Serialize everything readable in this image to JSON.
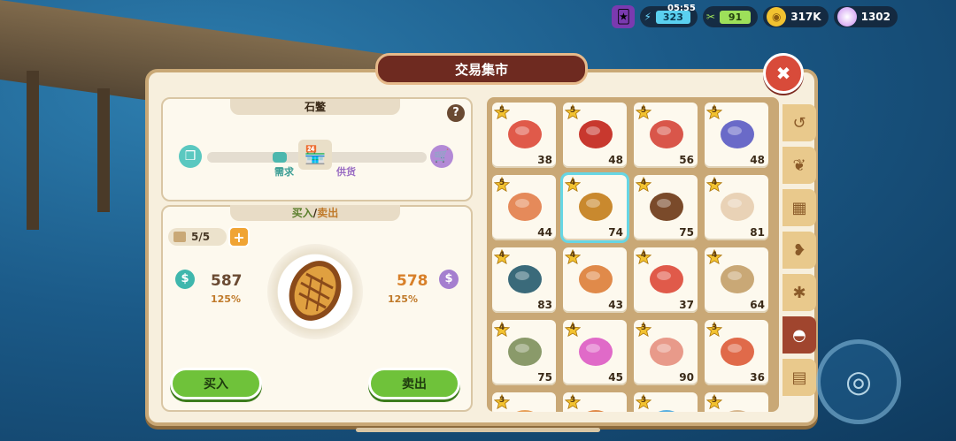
{
  "hud": {
    "energy": "323",
    "timer": "05:55",
    "stamina": "91",
    "coins": "317K",
    "gems": "1302"
  },
  "window": {
    "title": "交易集市"
  },
  "item_info": {
    "name": "石鳖",
    "demand_label": "需求",
    "supply_label": "供货",
    "demand_level": 0.33
  },
  "trade": {
    "title_buy": "买入",
    "title_slash": "/",
    "title_sell": "卖出",
    "stock": "5/5",
    "buy_price": "587",
    "sell_price": "578",
    "buy_pct": "125%",
    "sell_pct": "125%",
    "buy_button": "买入",
    "sell_button": "卖出"
  },
  "grid": [
    {
      "tier": "5",
      "count": "38",
      "icon": "crab-icon",
      "color": "#e05a4a"
    },
    {
      "tier": "5",
      "count": "48",
      "icon": "lobster-icon",
      "color": "#c8382e"
    },
    {
      "tier": "5",
      "count": "56",
      "icon": "crab-icon",
      "color": "#d9564a"
    },
    {
      "tier": "5",
      "count": "48",
      "icon": "sea-urchin-icon",
      "color": "#6a6ac8"
    },
    {
      "tier": "5",
      "count": "44",
      "icon": "clam-icon",
      "color": "#e58a5a"
    },
    {
      "tier": "4",
      "count": "74",
      "icon": "chiton-icon",
      "color": "#c9892e",
      "selected": true
    },
    {
      "tier": "4",
      "count": "75",
      "icon": "sea-cucumber-icon",
      "color": "#7a4a2a"
    },
    {
      "tier": "4",
      "count": "81",
      "icon": "squid-icon",
      "color": "#e9d2b6"
    },
    {
      "tier": "4",
      "count": "83",
      "icon": "lobster-icon",
      "color": "#3a6a7a"
    },
    {
      "tier": "4",
      "count": "43",
      "icon": "hermit-crab-icon",
      "color": "#e08a4a"
    },
    {
      "tier": "4",
      "count": "37",
      "icon": "starfish-icon",
      "color": "#e05a4a"
    },
    {
      "tier": "4",
      "count": "64",
      "icon": "oyster-icon",
      "color": "#c9a876"
    },
    {
      "tier": "4",
      "count": "75",
      "icon": "mussel-icon",
      "color": "#8a9a6a"
    },
    {
      "tier": "4",
      "count": "45",
      "icon": "sea-anemone-icon",
      "color": "#e06ac8"
    },
    {
      "tier": "3",
      "count": "90",
      "icon": "scallop-icon",
      "color": "#e89a8a"
    },
    {
      "tier": "3",
      "count": "36",
      "icon": "nautilus-icon",
      "color": "#e06a4a"
    },
    {
      "tier": "3",
      "count": "",
      "icon": "shrimp-icon",
      "color": "#e8a05a"
    },
    {
      "tier": "3",
      "count": "",
      "icon": "fish-icon",
      "color": "#e08a4a"
    },
    {
      "tier": "3",
      "count": "",
      "icon": "jellyfish-icon",
      "color": "#5ab0e0"
    },
    {
      "tier": "3",
      "count": "",
      "icon": "shell-icon",
      "color": "#d8b890"
    }
  ],
  "tabs": [
    "history-icon",
    "seaweed-icon",
    "crate-icon",
    "fish-icon",
    "beetle-icon",
    "shell-icon",
    "cargo-icon"
  ]
}
